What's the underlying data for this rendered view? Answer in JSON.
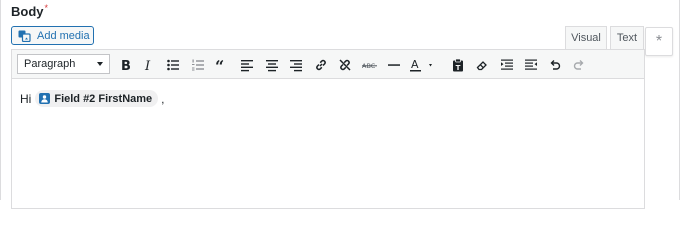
{
  "field": {
    "label": "Body",
    "required_marker": "*"
  },
  "media": {
    "add_media_label": "Add media"
  },
  "tabs": {
    "visual": "Visual",
    "text": "Text"
  },
  "side": {
    "marker": "*"
  },
  "toolbar": {
    "format_value": "Paragraph",
    "buttons": [
      "bold-icon",
      "italic-icon",
      "bulleted-list-icon",
      "numbered-list-icon",
      "blockquote-icon",
      "align-left-icon",
      "align-center-icon",
      "align-right-icon",
      "insert-link-icon",
      "remove-link-icon",
      "strikethrough-icon",
      "horizontal-line-icon",
      "text-color-icon",
      "paste-as-text-icon",
      "clear-formatting-icon",
      "indent-icon",
      "outdent-icon",
      "undo-icon",
      "redo-icon"
    ]
  },
  "content": {
    "greeting": "Hi",
    "merge_tag": "Field #2 FirstName",
    "trailing": ","
  },
  "colors": {
    "link_blue": "#2271b1",
    "required_red": "#d63638",
    "toolbar_bg": "#f6f7f7",
    "border": "#dcdcde"
  }
}
